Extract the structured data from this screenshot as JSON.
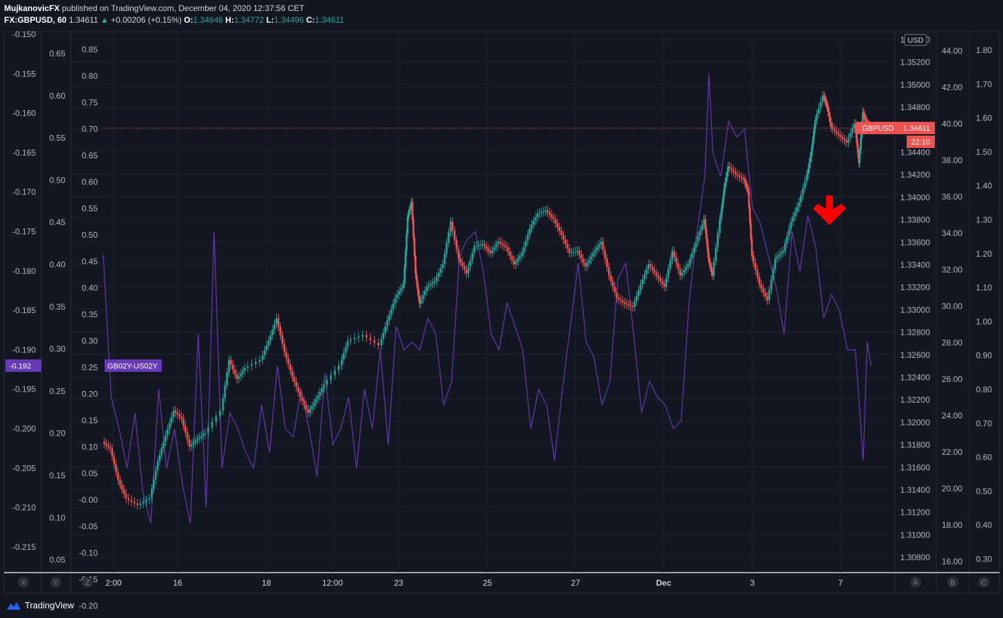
{
  "header": {
    "author": "MujkanovicFX",
    "published": "published on TradingView.com, December 04, 2020 12:37:56 CET",
    "symbol": "FX:GBPUSD, 60",
    "last": "1.34611",
    "change": "+0.00206 (+0.15%)",
    "o_label": "O:",
    "o": "1.34646",
    "h_label": "H:",
    "h": "1.34772",
    "l_label": "L:",
    "l": "1.34496",
    "c_label": "C:",
    "c": "1.34611"
  },
  "colors": {
    "background": "#131722",
    "up": "#26a69a",
    "down": "#ef5350",
    "spread_line": "#673ab7",
    "price_tag": "#ef5350",
    "arrow": "#ff0000"
  },
  "chart_data": {
    "type": "candlestick",
    "symbol": "GBPUSD",
    "last_price_label": "1.34611",
    "countdown": "22:10",
    "currency": "USD",
    "overlay_name": "GB02Y-US02Y",
    "overlay_value": "-0.192",
    "x_ticks": [
      "2:00",
      "16",
      "18",
      "12:00",
      "23",
      "25",
      "27",
      "Dec",
      "3",
      "7"
    ],
    "price_axis": [
      "1.35400",
      "1.35200",
      "1.35000",
      "1.34800",
      "1.34600",
      "1.34400",
      "1.34200",
      "1.34000",
      "1.33800",
      "1.33600",
      "1.33400",
      "1.33200",
      "1.33000",
      "1.32800",
      "1.32600",
      "1.32400",
      "1.32200",
      "1.32000",
      "1.31800",
      "1.31600",
      "1.31400",
      "1.31200",
      "1.31000",
      "1.30800"
    ],
    "axis_a": [
      "44.00",
      "42.00",
      "40.00",
      "38.00",
      "36.00",
      "34.00",
      "32.00",
      "30.00",
      "28.00",
      "26.00",
      "24.00",
      "22.00",
      "20.00",
      "18.00",
      "16.00"
    ],
    "axis_b": [
      "1.80",
      "1.70",
      "1.60",
      "1.50",
      "1.40",
      "1.30",
      "1.20",
      "1.10",
      "1.00",
      "0.90",
      "0.80",
      "0.70",
      "0.60",
      "0.50",
      "0.40",
      "0.30"
    ],
    "axis_x": [
      "-0.150",
      "-0.155",
      "-0.160",
      "-0.165",
      "-0.170",
      "-0.175",
      "-0.180",
      "-0.185",
      "-0.190",
      "-0.195",
      "-0.200",
      "-0.205",
      "-0.210",
      "-0.215"
    ],
    "axis_y": [
      "0.65",
      "0.60",
      "0.55",
      "0.50",
      "0.45",
      "0.40",
      "0.35",
      "0.30",
      "0.25",
      "0.20",
      "0.15",
      "0.10",
      "0.05"
    ],
    "axis_z": [
      "0.85",
      "0.80",
      "0.75",
      "0.70",
      "0.65",
      "0.60",
      "0.55",
      "0.50",
      "0.45",
      "0.40",
      "0.35",
      "0.30",
      "0.25",
      "0.20",
      "0.15",
      "0.10",
      "0.05",
      "-0.00",
      "-0.05",
      "-0.10",
      "-0.15",
      "-0.20"
    ],
    "axis_letters": [
      "X",
      "Y",
      "Z",
      "A",
      "B",
      "C"
    ],
    "price_path": [
      [
        0,
        1.3182
      ],
      [
        0.01,
        1.3176
      ],
      [
        0.02,
        1.3148
      ],
      [
        0.03,
        1.3132
      ],
      [
        0.045,
        1.3126
      ],
      [
        0.06,
        1.3132
      ],
      [
        0.07,
        1.3165
      ],
      [
        0.08,
        1.3188
      ],
      [
        0.09,
        1.321
      ],
      [
        0.1,
        1.3203
      ],
      [
        0.11,
        1.3178
      ],
      [
        0.12,
        1.3185
      ],
      [
        0.13,
        1.319
      ],
      [
        0.15,
        1.321
      ],
      [
        0.16,
        1.3255
      ],
      [
        0.17,
        1.3238
      ],
      [
        0.18,
        1.3248
      ],
      [
        0.2,
        1.3255
      ],
      [
        0.21,
        1.3272
      ],
      [
        0.22,
        1.3292
      ],
      [
        0.23,
        1.3262
      ],
      [
        0.24,
        1.324
      ],
      [
        0.25,
        1.3222
      ],
      [
        0.26,
        1.3208
      ],
      [
        0.27,
        1.322
      ],
      [
        0.28,
        1.3233
      ],
      [
        0.3,
        1.325
      ],
      [
        0.31,
        1.3272
      ],
      [
        0.33,
        1.3277
      ],
      [
        0.35,
        1.3268
      ],
      [
        0.36,
        1.329
      ],
      [
        0.37,
        1.331
      ],
      [
        0.38,
        1.3322
      ],
      [
        0.385,
        1.3382
      ],
      [
        0.39,
        1.3395
      ],
      [
        0.395,
        1.3332
      ],
      [
        0.4,
        1.3305
      ],
      [
        0.41,
        1.332
      ],
      [
        0.42,
        1.3325
      ],
      [
        0.43,
        1.334
      ],
      [
        0.44,
        1.3378
      ],
      [
        0.45,
        1.3345
      ],
      [
        0.46,
        1.3332
      ],
      [
        0.47,
        1.3356
      ],
      [
        0.48,
        1.3358
      ],
      [
        0.49,
        1.335
      ],
      [
        0.5,
        1.336
      ],
      [
        0.51,
        1.3355
      ],
      [
        0.52,
        1.334
      ],
      [
        0.53,
        1.335
      ],
      [
        0.54,
        1.3372
      ],
      [
        0.55,
        1.3385
      ],
      [
        0.56,
        1.3388
      ],
      [
        0.57,
        1.338
      ],
      [
        0.58,
        1.3366
      ],
      [
        0.59,
        1.335
      ],
      [
        0.6,
        1.3352
      ],
      [
        0.61,
        1.3338
      ],
      [
        0.62,
        1.335
      ],
      [
        0.63,
        1.336
      ],
      [
        0.64,
        1.333
      ],
      [
        0.65,
        1.331
      ],
      [
        0.66,
        1.3305
      ],
      [
        0.67,
        1.3302
      ],
      [
        0.68,
        1.3322
      ],
      [
        0.69,
        1.334
      ],
      [
        0.7,
        1.333
      ],
      [
        0.71,
        1.332
      ],
      [
        0.72,
        1.3352
      ],
      [
        0.73,
        1.333
      ],
      [
        0.74,
        1.334
      ],
      [
        0.75,
        1.336
      ],
      [
        0.76,
        1.338
      ],
      [
        0.765,
        1.3345
      ],
      [
        0.77,
        1.333
      ],
      [
        0.78,
        1.338
      ],
      [
        0.785,
        1.3408
      ],
      [
        0.79,
        1.3427
      ],
      [
        0.8,
        1.342
      ],
      [
        0.81,
        1.3415
      ],
      [
        0.815,
        1.3405
      ],
      [
        0.82,
        1.3348
      ],
      [
        0.83,
        1.3322
      ],
      [
        0.84,
        1.3308
      ],
      [
        0.85,
        1.3345
      ],
      [
        0.86,
        1.3352
      ],
      [
        0.87,
        1.3378
      ],
      [
        0.88,
        1.3395
      ],
      [
        0.89,
        1.342
      ],
      [
        0.895,
        1.344
      ],
      [
        0.9,
        1.3468
      ],
      [
        0.91,
        1.349
      ],
      [
        0.915,
        1.348
      ],
      [
        0.92,
        1.3462
      ],
      [
        0.93,
        1.3455
      ],
      [
        0.94,
        1.3448
      ],
      [
        0.95,
        1.3465
      ],
      [
        0.955,
        1.343
      ],
      [
        0.96,
        1.3475
      ],
      [
        0.965,
        1.3465
      ],
      [
        0.97,
        1.3462
      ]
    ],
    "spread_path": [
      [
        0,
        -0.178
      ],
      [
        0.01,
        -0.196
      ],
      [
        0.02,
        -0.2
      ],
      [
        0.03,
        -0.205
      ],
      [
        0.04,
        -0.198
      ],
      [
        0.05,
        -0.208
      ],
      [
        0.06,
        -0.212
      ],
      [
        0.07,
        -0.195
      ],
      [
        0.08,
        -0.205
      ],
      [
        0.09,
        -0.2
      ],
      [
        0.1,
        -0.207
      ],
      [
        0.11,
        -0.212
      ],
      [
        0.12,
        -0.188
      ],
      [
        0.13,
        -0.21
      ],
      [
        0.14,
        -0.175
      ],
      [
        0.15,
        -0.205
      ],
      [
        0.16,
        -0.198
      ],
      [
        0.17,
        -0.2
      ],
      [
        0.18,
        -0.203
      ],
      [
        0.19,
        -0.205
      ],
      [
        0.2,
        -0.197
      ],
      [
        0.21,
        -0.203
      ],
      [
        0.22,
        -0.192
      ],
      [
        0.23,
        -0.2
      ],
      [
        0.24,
        -0.201
      ],
      [
        0.25,
        -0.195
      ],
      [
        0.26,
        -0.2
      ],
      [
        0.27,
        -0.206
      ],
      [
        0.28,
        -0.193
      ],
      [
        0.29,
        -0.202
      ],
      [
        0.3,
        -0.2
      ],
      [
        0.31,
        -0.196
      ],
      [
        0.32,
        -0.205
      ],
      [
        0.33,
        -0.195
      ],
      [
        0.34,
        -0.2
      ],
      [
        0.35,
        -0.19
      ],
      [
        0.36,
        -0.202
      ],
      [
        0.37,
        -0.187
      ],
      [
        0.38,
        -0.19
      ],
      [
        0.39,
        -0.189
      ],
      [
        0.4,
        -0.19
      ],
      [
        0.41,
        -0.186
      ],
      [
        0.42,
        -0.188
      ],
      [
        0.43,
        -0.197
      ],
      [
        0.44,
        -0.194
      ],
      [
        0.45,
        -0.178
      ],
      [
        0.46,
        -0.176
      ],
      [
        0.47,
        -0.175
      ],
      [
        0.48,
        -0.18
      ],
      [
        0.49,
        -0.188
      ],
      [
        0.5,
        -0.19
      ],
      [
        0.51,
        -0.184
      ],
      [
        0.52,
        -0.187
      ],
      [
        0.53,
        -0.19
      ],
      [
        0.54,
        -0.2
      ],
      [
        0.55,
        -0.195
      ],
      [
        0.56,
        -0.197
      ],
      [
        0.57,
        -0.204
      ],
      [
        0.58,
        -0.195
      ],
      [
        0.59,
        -0.187
      ],
      [
        0.6,
        -0.179
      ],
      [
        0.61,
        -0.189
      ],
      [
        0.62,
        -0.191
      ],
      [
        0.63,
        -0.197
      ],
      [
        0.64,
        -0.194
      ],
      [
        0.65,
        -0.181
      ],
      [
        0.66,
        -0.179
      ],
      [
        0.67,
        -0.188
      ],
      [
        0.68,
        -0.198
      ],
      [
        0.69,
        -0.194
      ],
      [
        0.7,
        -0.196
      ],
      [
        0.71,
        -0.197
      ],
      [
        0.72,
        -0.2
      ],
      [
        0.73,
        -0.199
      ],
      [
        0.74,
        -0.184
      ],
      [
        0.75,
        -0.175
      ],
      [
        0.76,
        -0.168
      ],
      [
        0.765,
        -0.155
      ],
      [
        0.77,
        -0.165
      ],
      [
        0.78,
        -0.168
      ],
      [
        0.79,
        -0.161
      ],
      [
        0.8,
        -0.163
      ],
      [
        0.81,
        -0.162
      ],
      [
        0.82,
        -0.172
      ],
      [
        0.83,
        -0.174
      ],
      [
        0.84,
        -0.178
      ],
      [
        0.85,
        -0.182
      ],
      [
        0.86,
        -0.188
      ],
      [
        0.87,
        -0.175
      ],
      [
        0.88,
        -0.18
      ],
      [
        0.89,
        -0.173
      ],
      [
        0.9,
        -0.177
      ],
      [
        0.91,
        -0.186
      ],
      [
        0.92,
        -0.183
      ],
      [
        0.93,
        -0.185
      ],
      [
        0.94,
        -0.19
      ],
      [
        0.95,
        -0.19
      ],
      [
        0.96,
        -0.204
      ],
      [
        0.965,
        -0.189
      ],
      [
        0.97,
        -0.192
      ]
    ]
  },
  "footer": {
    "brand": "TradingView"
  }
}
